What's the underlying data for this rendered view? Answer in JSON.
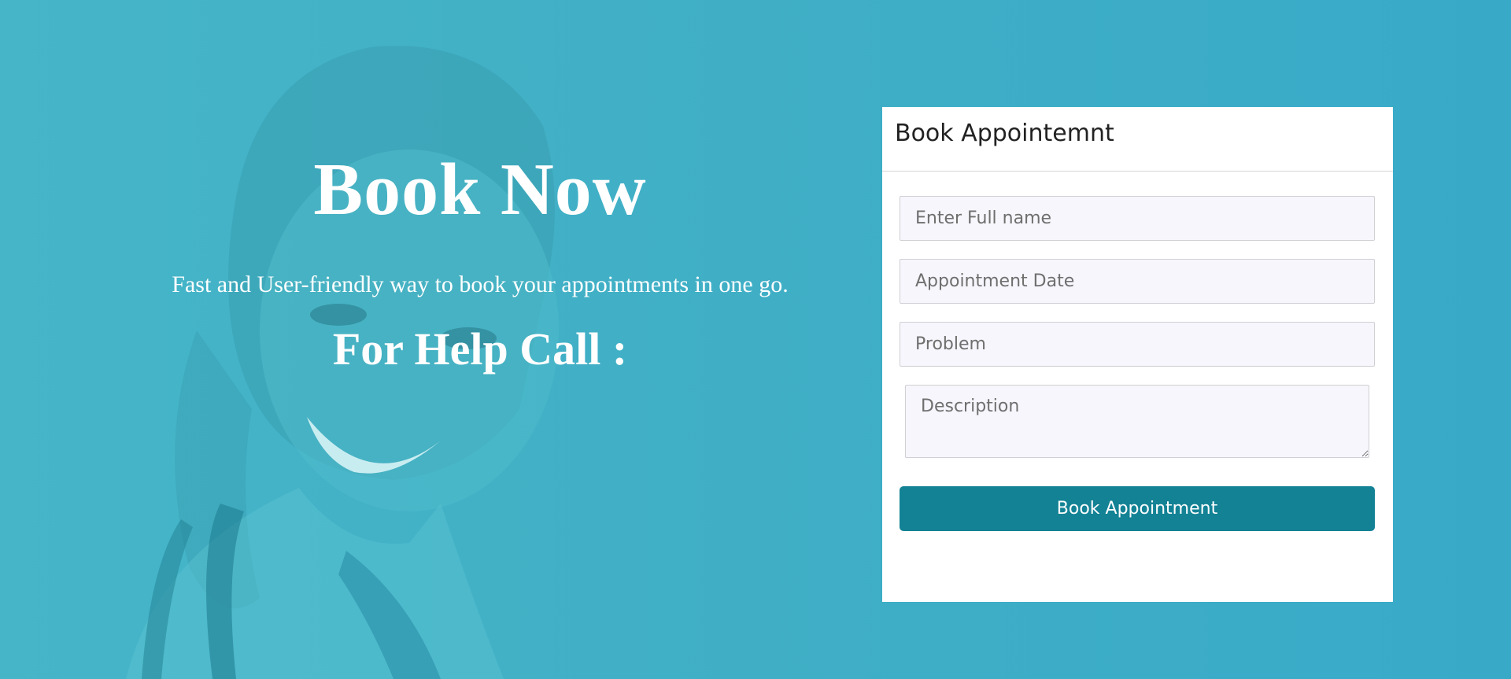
{
  "hero": {
    "title": "Book Now",
    "tagline": "Fast and User-friendly way to book your appointments in one go.",
    "help_heading": "For Help Call :"
  },
  "form": {
    "title": "Book Appointemnt",
    "full_name_placeholder": "Enter Full name",
    "date_placeholder": "Appointment Date",
    "problem_placeholder": "Problem",
    "description_placeholder": "Description",
    "submit_label": "Book Appointment"
  },
  "colors": {
    "background": "#41b0c6",
    "button": "#138295",
    "card": "#ffffff"
  }
}
